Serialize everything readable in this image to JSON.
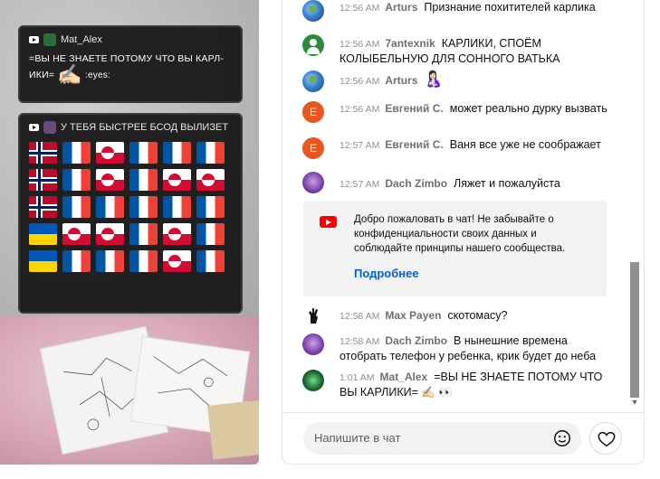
{
  "overlay": {
    "msg1": {
      "author": "Mat_Alex",
      "line1": "=ВЫ НЕ ЗНАЕТЕ ПОТОМУ ЧТО ВЫ КАРЛ-",
      "line2_prefix": "ИКИ=",
      "emoji": "✍🏻",
      "line2_suffix": ":eyes:"
    },
    "msg2": {
      "text": "У ТЕБЯ БЫСТРЕЕ БСОД ВЫЛИЗЕТ"
    },
    "flags": [
      "norway",
      "france",
      "greenland",
      "france",
      "france",
      "france",
      "norway",
      "france",
      "greenland",
      "france",
      "greenland",
      "greenland",
      "norway",
      "france",
      "france",
      "france",
      "france",
      "france",
      "ukraine",
      "greenland",
      "greenland",
      "france",
      "greenland",
      "france",
      "ukraine",
      "france",
      "france",
      "france",
      "greenland",
      "france"
    ]
  },
  "chat": {
    "messages": [
      {
        "time": "12:56 AM",
        "author": "Arturs",
        "text": "Признание похитителей карлика",
        "avatar": "earth-avatar"
      },
      {
        "time": "12:56 AM",
        "author": "7antexnik",
        "text": "КАРЛИКИ, СПОЁМ КОЛЫБЕЛЬНУЮ ДЛЯ СОННОГО ВАТЬКА",
        "avatar": "person-avatar"
      },
      {
        "time": "12:56 AM",
        "author": "Arturs",
        "text": "🤱🏻",
        "avatar": "earth-avatar"
      },
      {
        "time": "12:56 AM",
        "author": "Евгений С.",
        "text": "может реально дурку вызвать",
        "avatar": "letter-avatar",
        "avatar_letter": "Е"
      },
      {
        "time": "12:57 AM",
        "author": "Евгений С.",
        "text": "Ваня все уже не соображает",
        "avatar": "letter-avatar",
        "avatar_letter": "Е"
      },
      {
        "time": "12:57 AM",
        "author": "Dach Zimbo",
        "text": "Ляжет и пожалуйста",
        "avatar": "purple-avatar"
      },
      {
        "time": "12:58 AM",
        "author": "Max Payen",
        "text": "скотомасу?",
        "avatar": "hand-avatar"
      },
      {
        "time": "12:58 AM",
        "author": "Dach Zimbo",
        "text": "В нынешние времена отобрать телефон у ребенка, крик будет до неба",
        "avatar": "purple-avatar"
      },
      {
        "time": "1:01 AM",
        "author": "Mat_Alex",
        "text": "=ВЫ НЕ ЗНАЕТЕ ПОТОМУ ЧТО ВЫ КАРЛИКИ= ✍🏻 👀",
        "avatar": "green-avatar"
      }
    ],
    "welcome": {
      "text": "Добро пожаловать в чат! Не забывайте о конфиденциальности своих данных и соблюдайте принципы нашего сообщества.",
      "link": "Подробнее"
    },
    "input_placeholder": "Напишите в чат"
  },
  "colors": {
    "youtube_red": "#ff0000",
    "link_blue": "#065fd4",
    "letter_avatar": "#e8551f"
  }
}
